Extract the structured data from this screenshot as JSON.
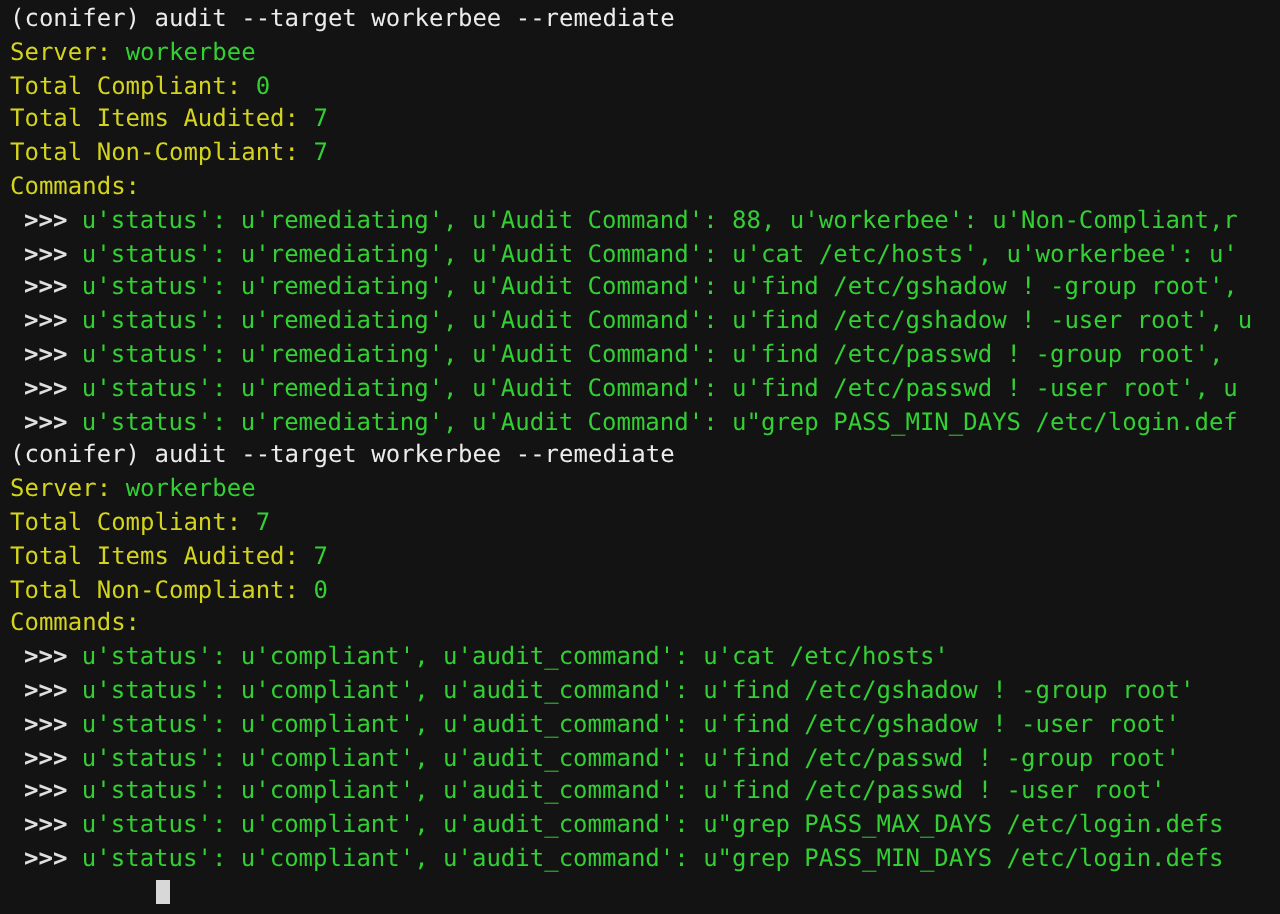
{
  "sessions": [
    {
      "command": "(conifer) audit --target workerbee --remediate",
      "server": {
        "label": "Server:",
        "value": "workerbee"
      },
      "stats": [
        {
          "label": "Total Compliant:",
          "value": "0"
        },
        {
          "label": "Total Items Audited:",
          "value": "7"
        },
        {
          "label": "Total Non-Compliant:",
          "value": "7"
        }
      ],
      "commands_label": "Commands:",
      "results": [
        {
          "prompt": ">>>",
          "text": "u'status': u'remediating', u'Audit Command': 88, u'workerbee': u'Non-Compliant,r"
        },
        {
          "prompt": ">>>",
          "text": "u'status': u'remediating', u'Audit Command': u'cat /etc/hosts', u'workerbee': u'"
        },
        {
          "prompt": ">>>",
          "text": "u'status': u'remediating', u'Audit Command': u'find /etc/gshadow ! -group root',"
        },
        {
          "prompt": ">>>",
          "text": "u'status': u'remediating', u'Audit Command': u'find /etc/gshadow ! -user root', u"
        },
        {
          "prompt": ">>>",
          "text": "u'status': u'remediating', u'Audit Command': u'find /etc/passwd ! -group root',"
        },
        {
          "prompt": ">>>",
          "text": "u'status': u'remediating', u'Audit Command': u'find /etc/passwd ! -user root', u"
        },
        {
          "prompt": ">>>",
          "text": "u'status': u'remediating', u'Audit Command': u\"grep PASS_MIN_DAYS /etc/login.def"
        }
      ]
    },
    {
      "command": "(conifer) audit --target workerbee --remediate",
      "server": {
        "label": "Server:",
        "value": "workerbee"
      },
      "stats": [
        {
          "label": "Total Compliant:",
          "value": "7"
        },
        {
          "label": "Total Items Audited:",
          "value": "7"
        },
        {
          "label": "Total Non-Compliant:",
          "value": "0"
        }
      ],
      "commands_label": "Commands:",
      "results": [
        {
          "prompt": ">>>",
          "text": "u'status': u'compliant', u'audit_command': u'cat /etc/hosts'"
        },
        {
          "prompt": ">>>",
          "text": "u'status': u'compliant', u'audit_command': u'find /etc/gshadow ! -group root'"
        },
        {
          "prompt": ">>>",
          "text": "u'status': u'compliant', u'audit_command': u'find /etc/gshadow ! -user root'"
        },
        {
          "prompt": ">>>",
          "text": "u'status': u'compliant', u'audit_command': u'find /etc/passwd ! -group root'"
        },
        {
          "prompt": ">>>",
          "text": "u'status': u'compliant', u'audit_command': u'find /etc/passwd ! -user root'"
        },
        {
          "prompt": ">>>",
          "text": "u'status': u'compliant', u'audit_command': u\"grep PASS_MAX_DAYS /etc/login.defs"
        },
        {
          "prompt": ">>>",
          "text": "u'status': u'compliant', u'audit_command': u\"grep PASS_MIN_DAYS /etc/login.defs"
        }
      ]
    }
  ]
}
